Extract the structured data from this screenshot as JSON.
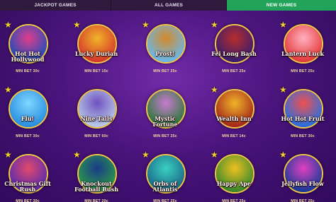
{
  "tabs": [
    {
      "label": "JACKPOT GAMES",
      "active": false
    },
    {
      "label": "ALL GAMES",
      "active": false
    },
    {
      "label": "NEW GAMES",
      "active": true
    }
  ],
  "colors": {
    "active_tab": "#22a35a",
    "tab_bg": "#2f1a3e",
    "gold": "#f3c64a"
  },
  "games": [
    {
      "title": "Hot Hot Hollywood",
      "bet": "MIN BET 30c",
      "star": true,
      "bg": [
        "#1d4db8",
        "#e23d8c"
      ]
    },
    {
      "title": "Lucky Durian",
      "bet": "MIN BET 15c",
      "star": true,
      "bg": [
        "#d73a2a",
        "#f0b429"
      ]
    },
    {
      "title": "Prost!",
      "bet": "MIN BET 25c",
      "star": true,
      "bg": [
        "#6bb7e8",
        "#d48a2a"
      ]
    },
    {
      "title": "Fei Long Bash",
      "bet": "MIN BET 25c",
      "star": true,
      "bg": [
        "#3b1d6d",
        "#b72d2d"
      ]
    },
    {
      "title": "Lantern Luck",
      "bet": "MIN BET 25c",
      "star": true,
      "bg": [
        "#e53c3c",
        "#ffb0c0"
      ]
    },
    {
      "title": "Flu!",
      "bet": "MIN BET 30c",
      "star": true,
      "bg": [
        "#2a8fe0",
        "#7fd6ff"
      ]
    },
    {
      "title": "Nine Tails",
      "bet": "MIN BET 60c",
      "star": false,
      "bg": [
        "#b7c8e8",
        "#7050c0"
      ]
    },
    {
      "title": "Mystic Fortune",
      "bet": "MIN BET 25c",
      "star": false,
      "bg": [
        "#2d7a3a",
        "#c97ad0"
      ]
    },
    {
      "title": "Wealth Inn",
      "bet": "MIN BET 14c",
      "star": true,
      "bg": [
        "#a52a1a",
        "#f0b429"
      ]
    },
    {
      "title": "Hot Hot Fruit",
      "bet": "MIN BET 30c",
      "star": true,
      "bg": [
        "#2a6fe0",
        "#f05050"
      ]
    },
    {
      "title": "Christmas Gift Rush",
      "bet": "MIN BET 30c",
      "star": true,
      "bg": [
        "#5a2ab0",
        "#e24a6a"
      ]
    },
    {
      "title": "Knockout Football Rush",
      "bet": "MIN BET 20c",
      "star": true,
      "bg": [
        "#2a9a4a",
        "#1a3a8a"
      ]
    },
    {
      "title": "Orbs of Atlantis",
      "bet": "MIN BET 25c",
      "star": true,
      "bg": [
        "#1a6a8a",
        "#3ad0c0"
      ]
    },
    {
      "title": "Happy Ape",
      "bet": "MIN BET 25c",
      "star": true,
      "bg": [
        "#3a8a2a",
        "#f0c020"
      ]
    },
    {
      "title": "Jellyfish Flow",
      "bet": "MIN BET 25c",
      "star": true,
      "bg": [
        "#1a3a9a",
        "#e040c0"
      ]
    }
  ]
}
